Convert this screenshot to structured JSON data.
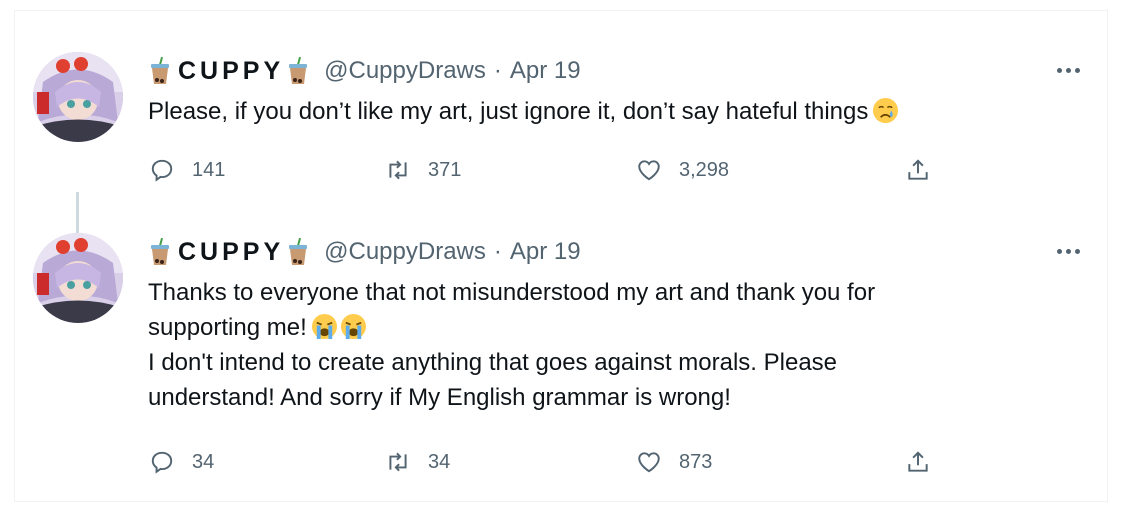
{
  "tweets": [
    {
      "display_name": "CUPPY",
      "handle": "@CuppyDraws",
      "separator": "·",
      "date": "Apr 19",
      "text_lines": [
        "Please, if you don’t like my art, just ignore it, don’t say hateful things"
      ],
      "emoji_icons": [
        "crying-face-icon"
      ],
      "replies": "141",
      "retweets": "371",
      "likes": "3,298"
    },
    {
      "display_name": "CUPPY",
      "handle": "@CuppyDraws",
      "separator": "·",
      "date": "Apr 19",
      "text_lines": [
        "Thanks to everyone that not misunderstood my art and thank you for",
        "supporting me!",
        "I don't intend to create anything that goes against morals. Please",
        "understand! And sorry if My English grammar is wrong!"
      ],
      "emoji_icons": [
        "loudly-crying-face-icon",
        "loudly-crying-face-icon"
      ],
      "replies": "34",
      "retweets": "34",
      "likes": "873"
    }
  ],
  "colors": {
    "text": "#0f1419",
    "muted": "#536471",
    "thread_line": "#cfd9de",
    "border": "#eff3f4"
  }
}
